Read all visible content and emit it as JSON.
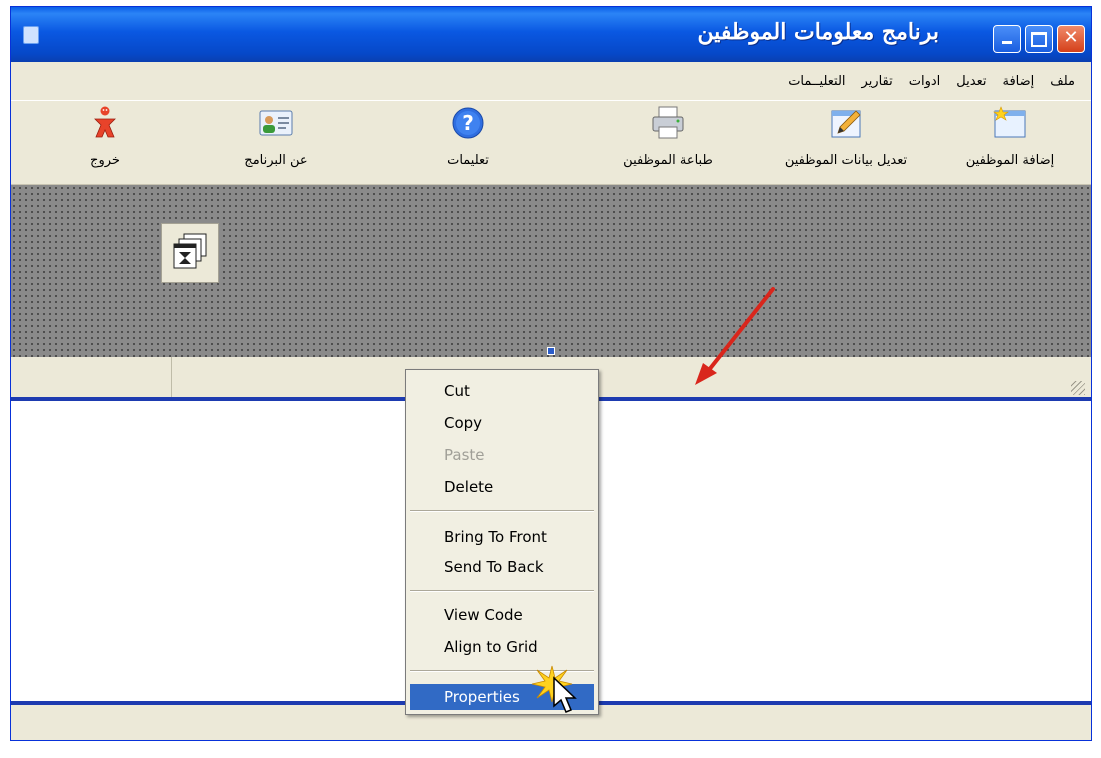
{
  "window": {
    "title": "برنامج معلومات  الموظفين",
    "controls": {
      "minimize": "minimize",
      "maximize": "maximize",
      "close": "✕"
    }
  },
  "menu": [
    "ملف",
    "إضافة",
    "تعديل",
    "ادوات",
    "تقارير",
    "التعليــمات"
  ],
  "toolbar": [
    {
      "label": "إضافة الموظفين",
      "icon": "add-form-icon"
    },
    {
      "label": "تعديل بيانات الموظفين",
      "icon": "edit-pencil-icon"
    },
    {
      "label": "طباعة الموظفين",
      "icon": "printer-icon"
    },
    {
      "label": "تعليمات",
      "icon": "help-icon"
    },
    {
      "label": "عن البرنامج",
      "icon": "user-card-icon"
    },
    {
      "label": "خروج",
      "icon": "exit-figure-icon"
    }
  ],
  "context_menu": {
    "items": [
      {
        "label": "Cut",
        "state": "normal"
      },
      {
        "label": "Copy",
        "state": "normal"
      },
      {
        "label": "Paste",
        "state": "disabled"
      },
      {
        "label": "Delete",
        "state": "normal"
      },
      {
        "label": "Bring To Front",
        "state": "normal"
      },
      {
        "label": "Send To Back",
        "state": "normal"
      },
      {
        "label": "View Code",
        "state": "normal"
      },
      {
        "label": "Align to Grid",
        "state": "normal"
      },
      {
        "label": "Properties",
        "state": "selected"
      }
    ]
  },
  "colors": {
    "titlebar": "#0a58e2",
    "face": "#ece9d8",
    "menu_highlight": "#316ac5",
    "annotation_arrow": "#d9261c"
  }
}
